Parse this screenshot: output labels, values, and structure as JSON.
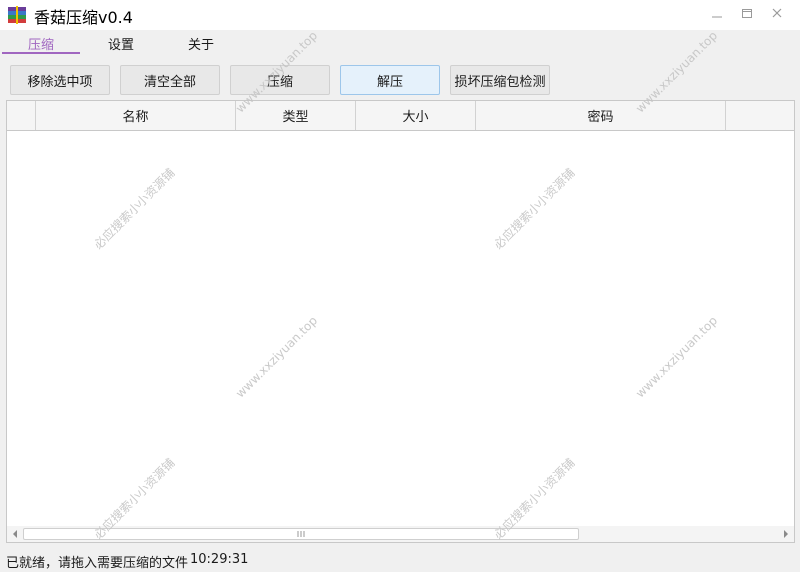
{
  "window": {
    "title": "香菇压缩v0.4",
    "app_icon": "stacked-books-icon",
    "controls": [
      "minimize-icon",
      "maximize-icon",
      "close-icon"
    ]
  },
  "tabs": [
    {
      "label": "压缩",
      "active": true
    },
    {
      "label": "设置",
      "active": false
    },
    {
      "label": "关于",
      "active": false
    }
  ],
  "toolbar": {
    "remove_selected": "移除选中项",
    "clear_all": "清空全部",
    "compress": "压缩",
    "decompress": "解压",
    "corrupt_check": "损坏压缩包检测"
  },
  "table": {
    "columns": [
      "名称",
      "类型",
      "大小",
      "密码"
    ],
    "rows": []
  },
  "status": {
    "message": "已就绪，请拖入需要压缩的文件",
    "time": "10:29:31"
  },
  "watermarks": {
    "site": "www.xxziyuan.top",
    "cn": "必应搜索小小资源铺"
  },
  "colors": {
    "accent": "#a066c0",
    "button_hover_bg": "#e5f1fb",
    "button_hover_border": "#9dc6ea",
    "watermark": "#c4c4c4"
  }
}
